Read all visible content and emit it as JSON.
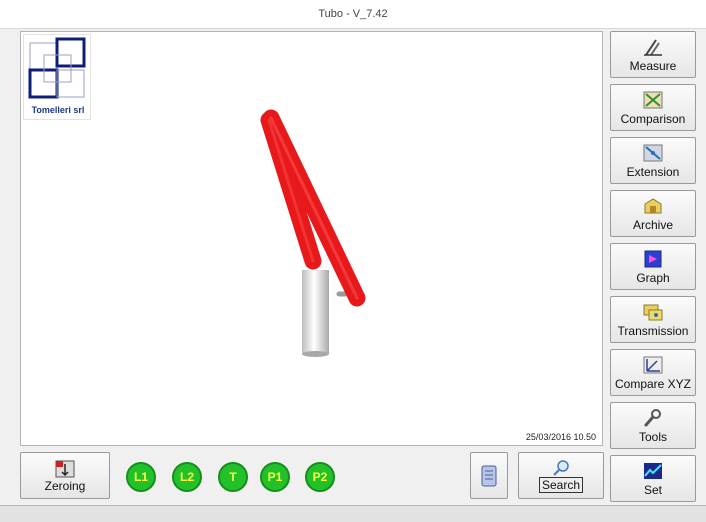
{
  "window": {
    "title": "Tubo - V_7.42"
  },
  "logo": {
    "company": "Tomelleri srl"
  },
  "viewport": {
    "datetime": "25/03/2016  10.50"
  },
  "sidebar": {
    "measure": "Measure",
    "comparison": "Comparison",
    "extension": "Extension",
    "archive": "Archive",
    "graph": "Graph",
    "transmission": "Transmission",
    "compare_xyz": "Compare XYZ",
    "tools": "Tools",
    "set": "Set"
  },
  "bottom": {
    "zeroing": "Zeroing",
    "search": "Search",
    "points": [
      "L1",
      "L2",
      "T",
      "P1",
      "P2"
    ]
  },
  "colors": {
    "tube": "#e8191b",
    "point_buttons": "#22c12a",
    "point_text": "#ffff40"
  }
}
